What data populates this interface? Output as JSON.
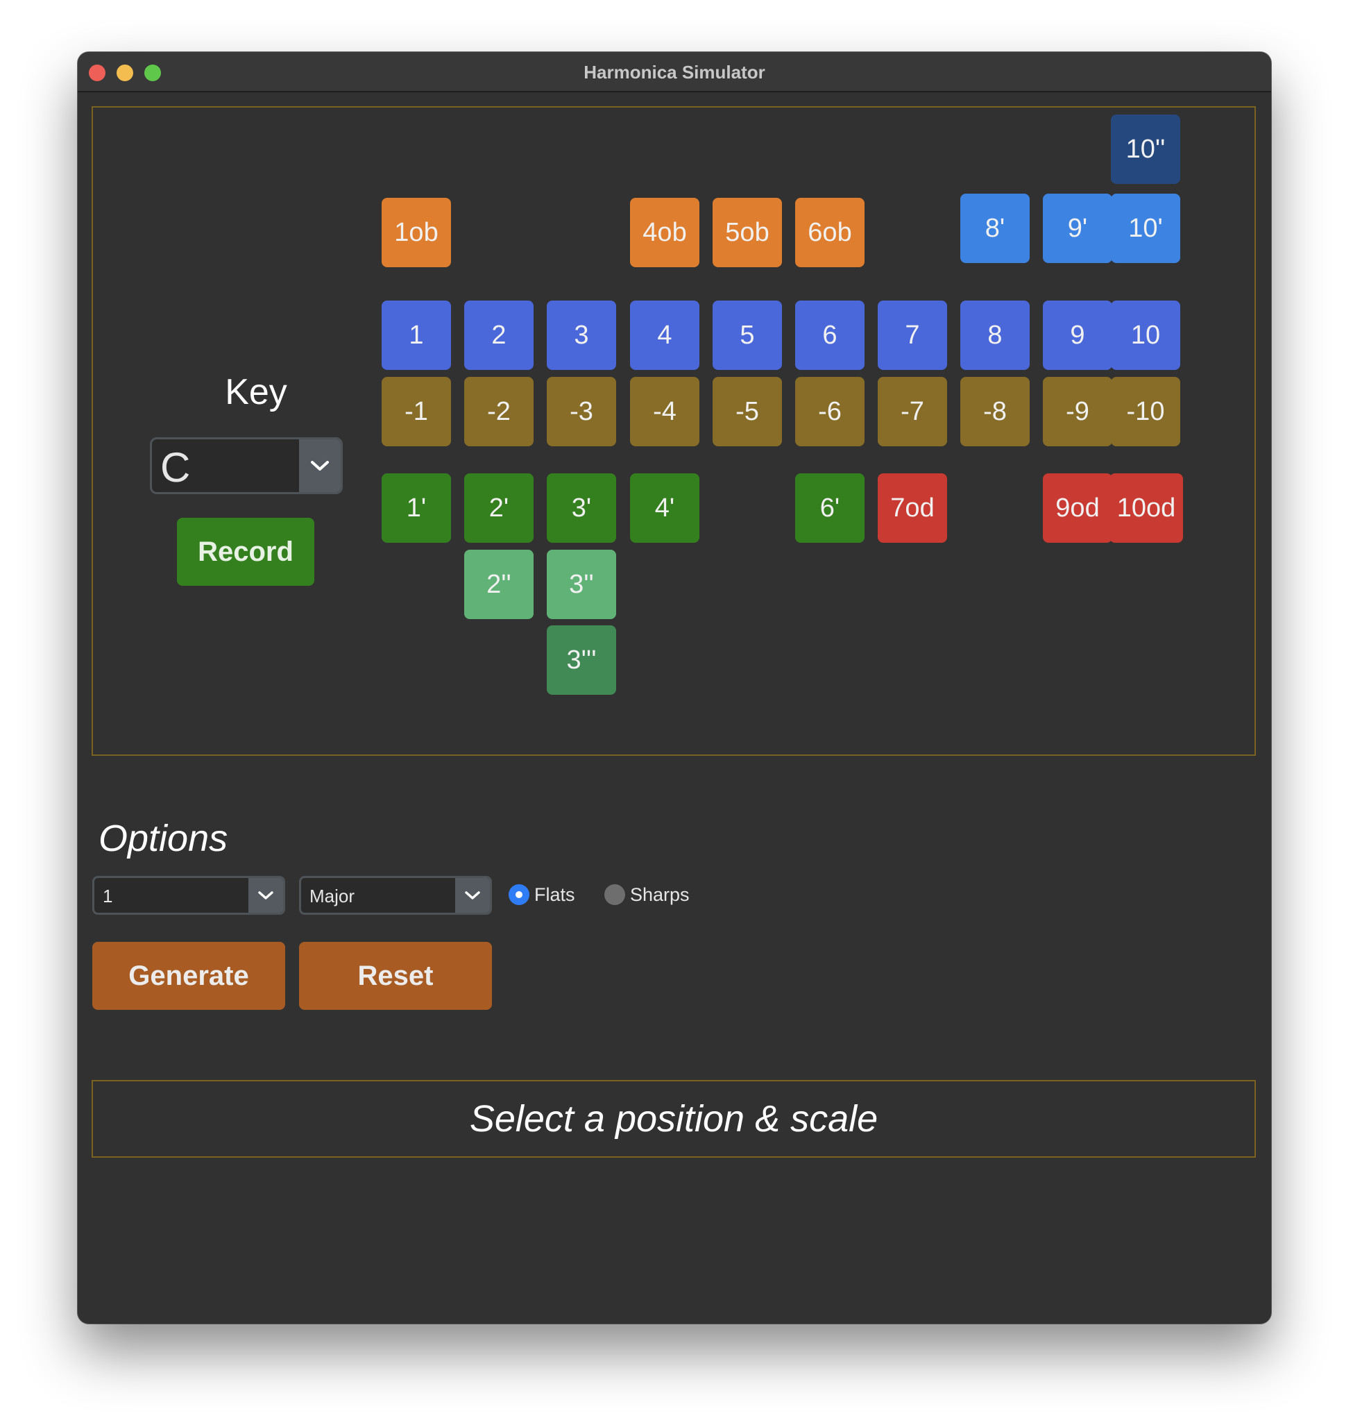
{
  "window": {
    "title": "Harmonica Simulator"
  },
  "key": {
    "label": "Key",
    "selected": "C"
  },
  "record_label": "Record",
  "holes": {
    "overblow_bend_2": [
      {
        "id": "10''",
        "color": "darkblue"
      }
    ],
    "overblows_and_blow_bends": [
      {
        "id": "1ob",
        "color": "orange"
      },
      {
        "id": "4ob",
        "color": "orange"
      },
      {
        "id": "5ob",
        "color": "orange"
      },
      {
        "id": "6ob",
        "color": "orange"
      },
      {
        "id": "8'",
        "color": "lightblue"
      },
      {
        "id": "9'",
        "color": "lightblue"
      },
      {
        "id": "10'",
        "color": "lightblue"
      }
    ],
    "blow": [
      "1",
      "2",
      "3",
      "4",
      "5",
      "6",
      "7",
      "8",
      "9",
      "10"
    ],
    "draw": [
      "-1",
      "-2",
      "-3",
      "-4",
      "-5",
      "-6",
      "-7",
      "-8",
      "-9",
      "-10"
    ],
    "draw_bends_1": [
      {
        "id": "1'",
        "color": "green"
      },
      {
        "id": "2'",
        "color": "green"
      },
      {
        "id": "3'",
        "color": "green"
      },
      {
        "id": "4'",
        "color": "green"
      },
      {
        "id": "6'",
        "color": "green"
      },
      {
        "id": "7od",
        "color": "red"
      },
      {
        "id": "9od",
        "color": "red"
      },
      {
        "id": "10od",
        "color": "red"
      }
    ],
    "draw_bends_2": [
      "2''",
      "3''"
    ],
    "draw_bends_3": [
      "3'''"
    ]
  },
  "options": {
    "title": "Options",
    "position_value": "1",
    "scale_value": "Major",
    "flats_label": "Flats",
    "sharps_label": "Sharps",
    "accidental_selected": "Flats",
    "generate_label": "Generate",
    "reset_label": "Reset"
  },
  "status_text": "Select a position & scale",
  "colors": {
    "orange": "#e07e2f",
    "lightblue": "#3c83e2",
    "darkblue": "#25497f",
    "blue": "#4b68da",
    "olive": "#876d28",
    "green": "#34801f",
    "lightgreen": "#61b277",
    "midgreen": "#418a56",
    "red": "#c93a32",
    "action": "#a85c24",
    "panel_border": "#7a6320"
  }
}
